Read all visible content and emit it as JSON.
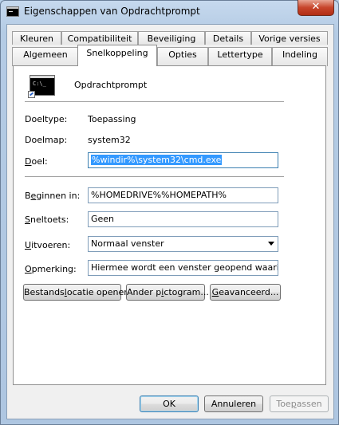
{
  "window": {
    "title": "Eigenschappen van Opdrachtprompt",
    "close_glyph": "✕"
  },
  "tabs": {
    "row1": [
      "Kleuren",
      "Compatibiliteit",
      "Beveiliging",
      "Details",
      "Vorige versies"
    ],
    "row2": [
      "Algemeen",
      "Snelkoppeling",
      "Opties",
      "Lettertype",
      "Indeling"
    ],
    "active": "Snelkoppeling"
  },
  "shortcut": {
    "name": "Opdrachtprompt",
    "target_type_label": "Doeltype:",
    "target_type": "Toepassing",
    "target_folder_label": "Doelmap:",
    "target_folder": "system32",
    "target_label_pre": "",
    "target_label_u": "D",
    "target_label_post": "oel:",
    "target_value": "%windir%\\system32\\cmd.exe",
    "start_in_label_pre": "B",
    "start_in_label_u": "e",
    "start_in_label_post": "ginnen in:",
    "start_in_value": "%HOMEDRIVE%%HOMEPATH%",
    "shortcut_key_label_pre": "",
    "shortcut_key_label_u": "S",
    "shortcut_key_label_post": "neltoets:",
    "shortcut_key_value": "Geen",
    "run_label_pre": "",
    "run_label_u": "U",
    "run_label_post": "itvoeren:",
    "run_value": "Normaal venster",
    "comment_label_pre": "",
    "comment_label_u": "O",
    "comment_label_post": "pmerking:",
    "comment_value": "Hiermee wordt een venster geopend waarin u tek"
  },
  "buttons": {
    "open_location_pre": "Bestands",
    "open_location_u": "l",
    "open_location_post": "ocatie openen",
    "change_icon_pre": "Ander p",
    "change_icon_u": "i",
    "change_icon_post": "ctogram...",
    "advanced_pre": "",
    "advanced_u": "G",
    "advanced_post": "eavanceerd...",
    "ok": "OK",
    "cancel": "Annuleren",
    "apply_pre": "Toe",
    "apply_u": "p",
    "apply_post": "assen"
  }
}
